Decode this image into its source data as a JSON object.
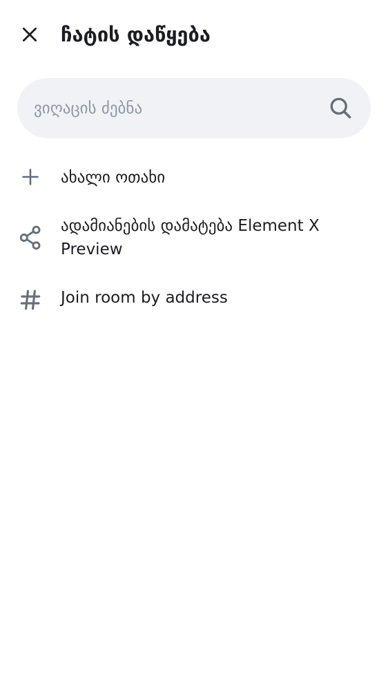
{
  "header": {
    "title": "ჩატის დაწყება",
    "close_icon": "close-icon"
  },
  "search": {
    "placeholder": "ვიღაცის ძებნა",
    "value": "",
    "icon": "search-icon"
  },
  "menu": {
    "items": [
      {
        "icon": "plus-icon",
        "label": "ახალი ოთახი"
      },
      {
        "icon": "share-icon",
        "label": "ადამიანების დამატება Element X Preview"
      },
      {
        "icon": "hash-icon",
        "label": "Join room by address"
      }
    ]
  },
  "colors": {
    "text": "#1b1d22",
    "icon": "#656d77",
    "search_bg": "#f0f2f5",
    "placeholder": "#8d97a5",
    "background": "#ffffff"
  }
}
